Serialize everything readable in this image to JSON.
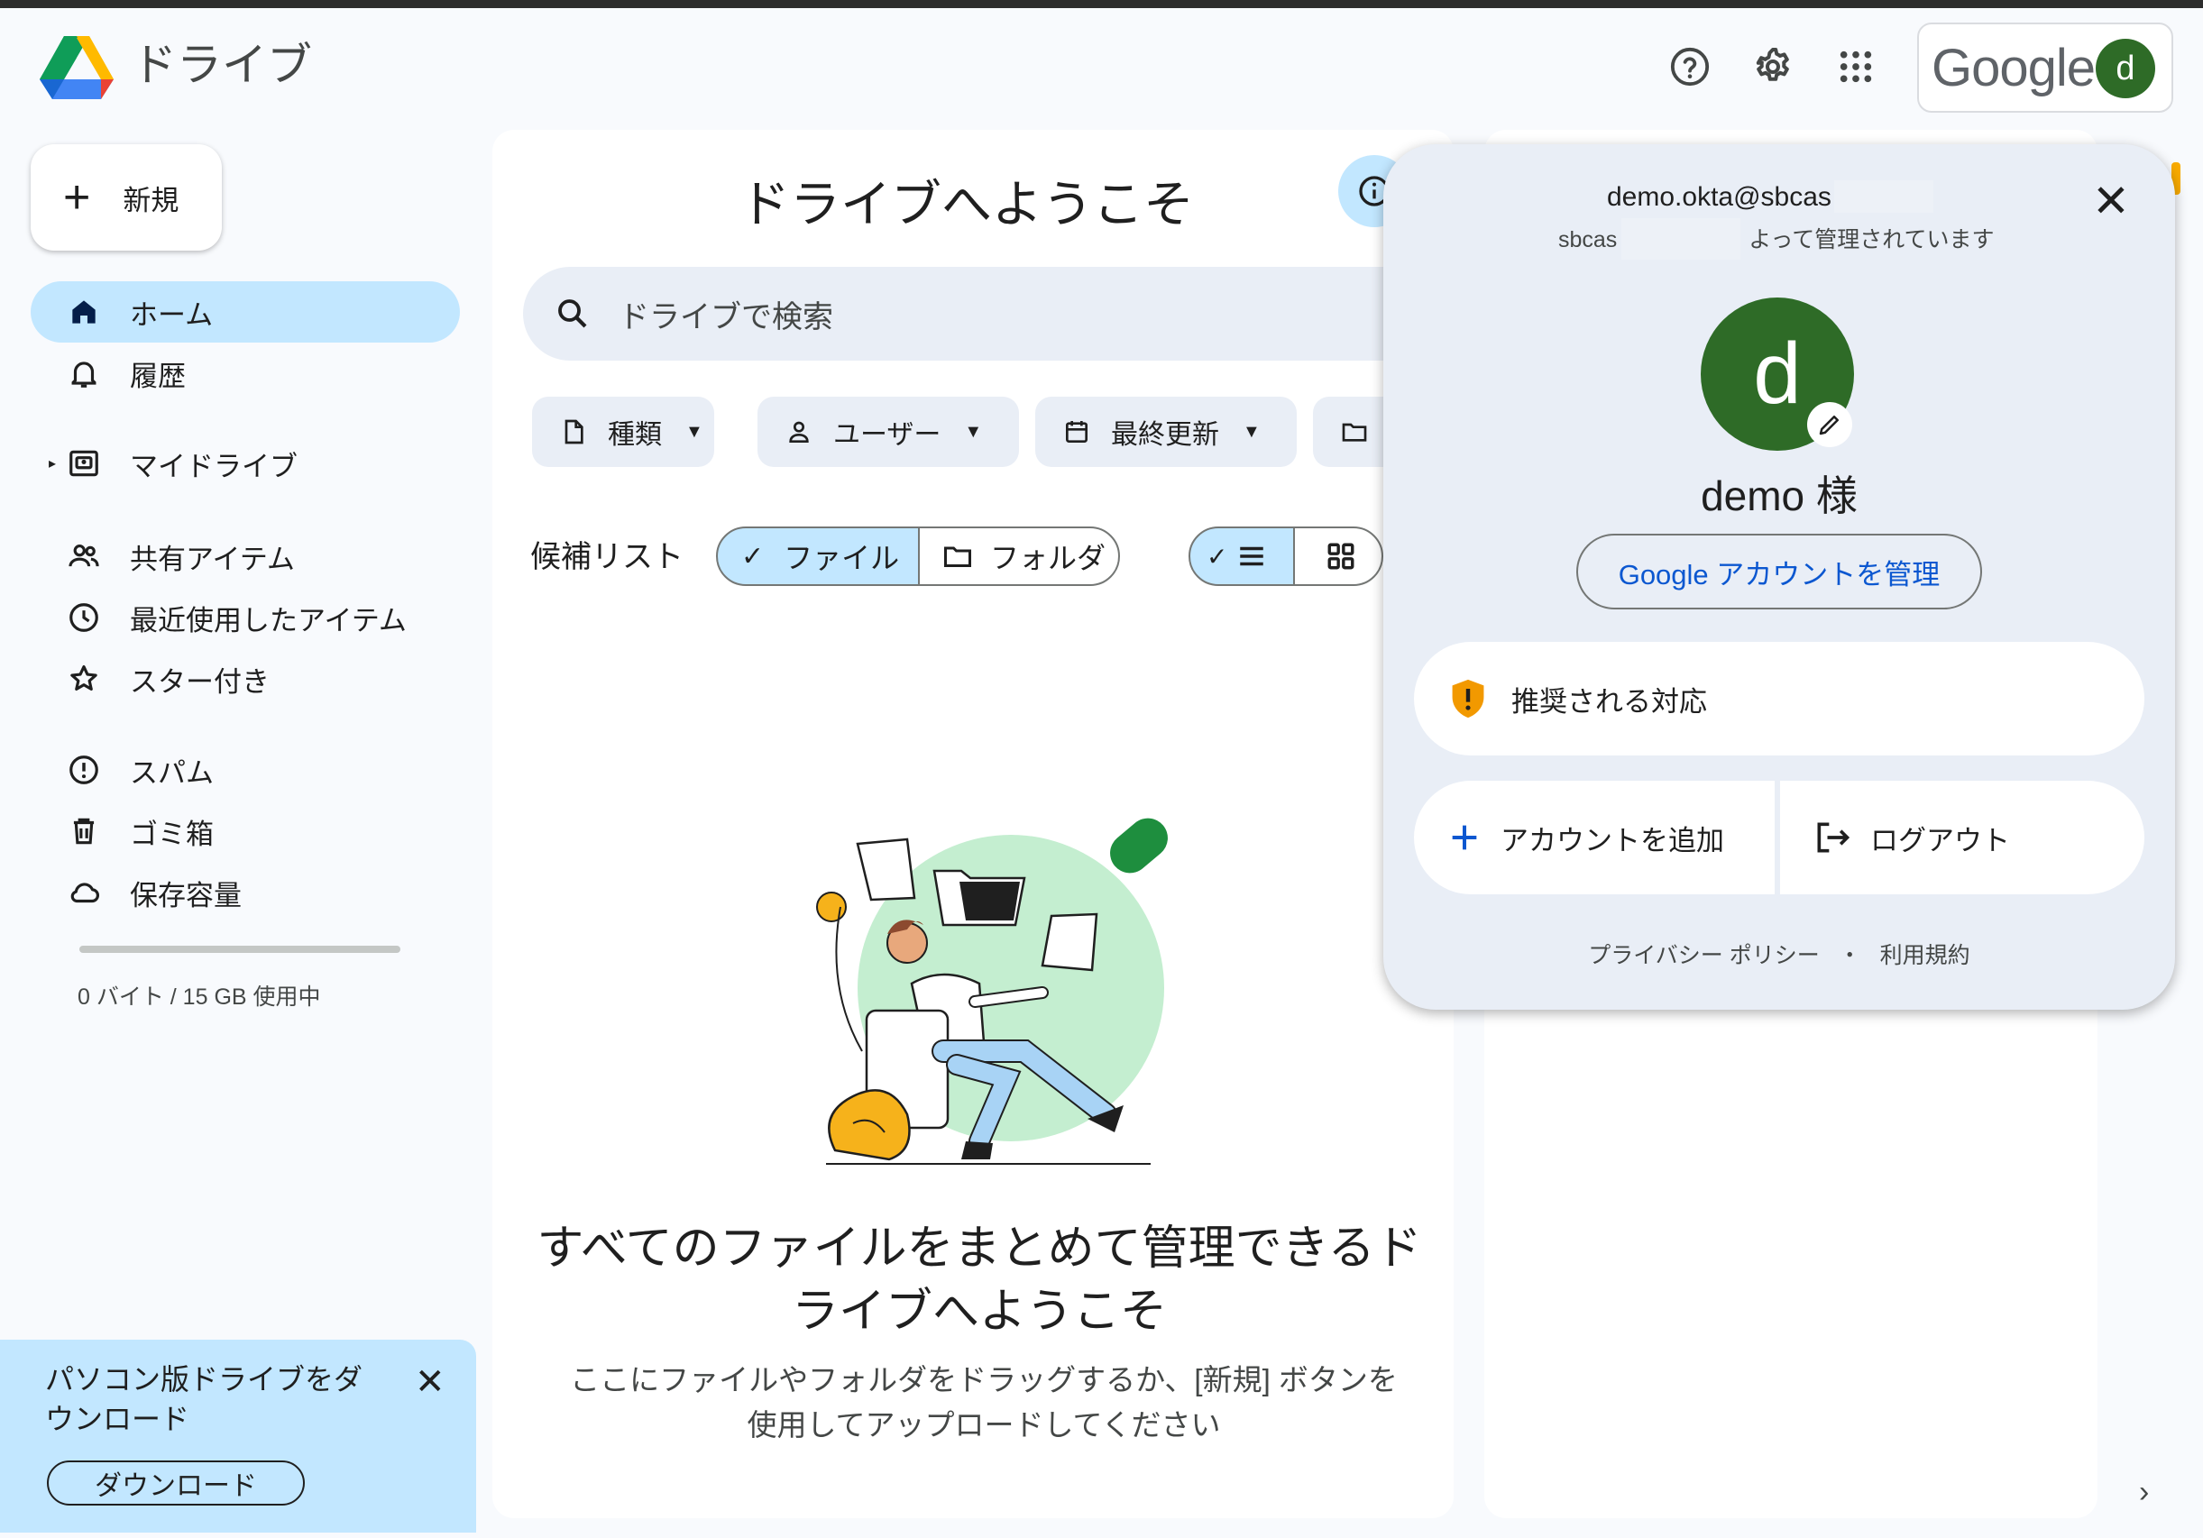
{
  "app": {
    "title": "ドライブ",
    "google_text": "Google",
    "avatar_letter": "d"
  },
  "sidebar": {
    "new_label": "新規",
    "items": [
      {
        "label": "ホーム"
      },
      {
        "label": "履歴"
      },
      {
        "label": "マイドライブ"
      },
      {
        "label": "共有アイテム"
      },
      {
        "label": "最近使用したアイテム"
      },
      {
        "label": "スター付き"
      },
      {
        "label": "スパム"
      },
      {
        "label": "ゴミ箱"
      },
      {
        "label": "保存容量"
      }
    ],
    "storage_text": "0 バイト / 15 GB 使用中",
    "storage_used_fraction": 0
  },
  "promo": {
    "text": "パソコン版ドライブをダウンロード",
    "download_label": "ダウンロード"
  },
  "main": {
    "title": "ドライブへようこそ",
    "search_placeholder": "ドライブで検索",
    "filters": [
      "種類",
      "ユーザー",
      "最終更新"
    ],
    "suggest_label": "候補リスト",
    "seg_file": "ファイル",
    "seg_folder": "フォルダ",
    "empty_title": "すべてのファイルをまとめて管理できるドライブへようこそ",
    "empty_desc": "ここにファイルやフォルダをドラッグするか、[新規] ボタンを使用してアップロードしてください"
  },
  "account_popup": {
    "email": "demo.okta@sbcas",
    "managed_prefix": "sbcas",
    "managed_suffix": "よって管理されています",
    "avatar_letter": "d",
    "greeting": "demo 様",
    "manage_label": "Google アカウントを管理",
    "recommended_label": "推奨される対応",
    "add_account_label": "アカウントを追加",
    "logout_label": "ログアウト",
    "privacy_label": "プライバシー ポリシー",
    "separator": "・",
    "terms_label": "利用規約"
  },
  "colors": {
    "accent": "#0b57d0",
    "active_bg": "#c2e7ff",
    "avatar": "#2e6b27",
    "warning": "#f29900"
  }
}
